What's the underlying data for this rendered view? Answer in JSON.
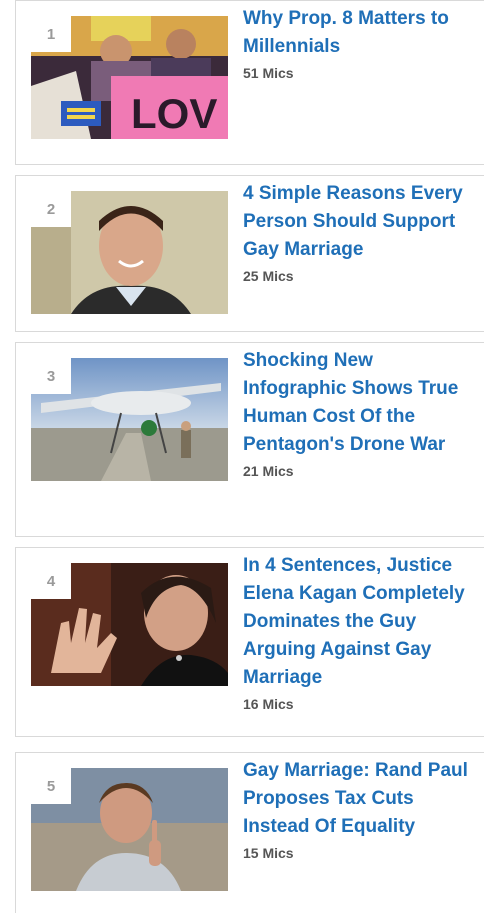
{
  "items": [
    {
      "rank": "1",
      "title": "Why Prop. 8 Matters to Millennials",
      "mics": "51 Mics",
      "image": "protest-photo"
    },
    {
      "rank": "2",
      "title": "4 Simple Reasons Every Person Should Support Gay Marriage",
      "mics": "25 Mics",
      "image": "smiling-man-photo"
    },
    {
      "rank": "3",
      "title": "Shocking New Infographic Shows True Human Cost Of the Pentagon's Drone War",
      "mics": "21 Mics",
      "image": "drone-photo"
    },
    {
      "rank": "4",
      "title": "In 4 Sentences, Justice Elena Kagan Completely Dominates the Guy Arguing Against Gay Marriage",
      "mics": "16 Mics",
      "image": "justice-kagan-photo"
    },
    {
      "rank": "5",
      "title": "Gay Marriage: Rand Paul Proposes Tax Cuts Instead Of Equality",
      "mics": "15 Mics",
      "image": "rand-paul-photo"
    }
  ]
}
